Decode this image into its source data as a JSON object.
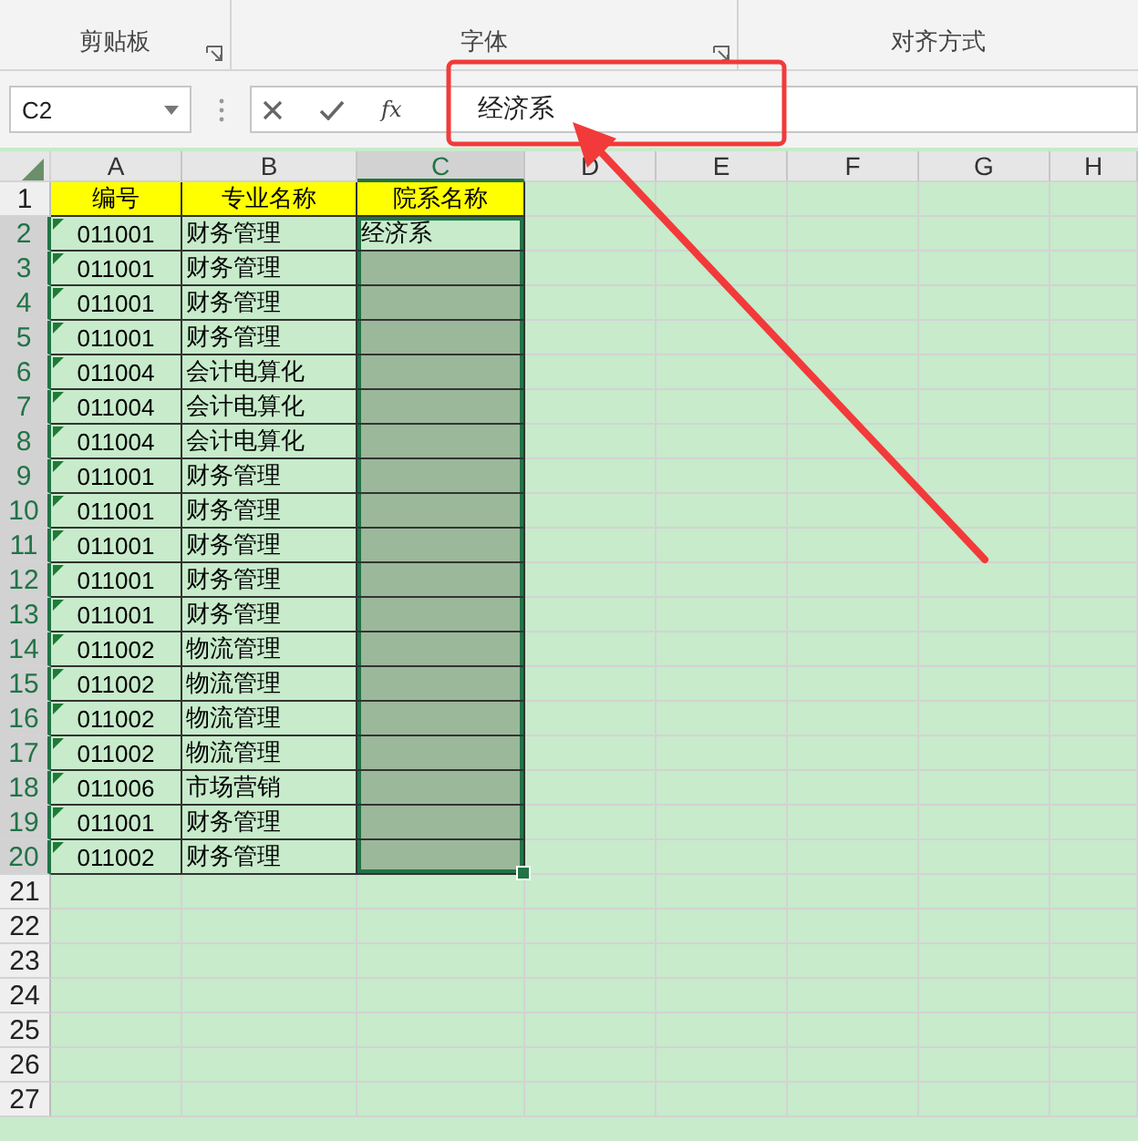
{
  "ribbon": {
    "groups": [
      {
        "label": "剪贴板",
        "launcher": true
      },
      {
        "label": "字体",
        "launcher": true
      },
      {
        "label": "对齐方式",
        "launcher": false
      }
    ]
  },
  "formula_bar": {
    "name_box": "C2",
    "function_label": "fx",
    "value": "经济系"
  },
  "sheet": {
    "columns": [
      {
        "label": "A",
        "selected": false
      },
      {
        "label": "B",
        "selected": false
      },
      {
        "label": "C",
        "selected": true
      },
      {
        "label": "D",
        "selected": false
      },
      {
        "label": "E",
        "selected": false
      },
      {
        "label": "F",
        "selected": false
      },
      {
        "label": "G",
        "selected": false
      },
      {
        "label": "H",
        "selected": false
      }
    ],
    "rows": [
      {
        "number": "1",
        "kind": "header",
        "selected": false,
        "flag": false,
        "cells": [
          "编号",
          "专业名称",
          "院系名称"
        ]
      },
      {
        "number": "2",
        "kind": "data",
        "selected": true,
        "flag": true,
        "cells": [
          "011001",
          "财务管理",
          "经济系"
        ]
      },
      {
        "number": "3",
        "kind": "data",
        "selected": true,
        "flag": true,
        "cells": [
          "011001",
          "财务管理",
          ""
        ]
      },
      {
        "number": "4",
        "kind": "data",
        "selected": true,
        "flag": true,
        "cells": [
          "011001",
          "财务管理",
          ""
        ]
      },
      {
        "number": "5",
        "kind": "data",
        "selected": true,
        "flag": true,
        "cells": [
          "011001",
          "财务管理",
          ""
        ]
      },
      {
        "number": "6",
        "kind": "data",
        "selected": true,
        "flag": true,
        "cells": [
          "011004",
          "会计电算化",
          ""
        ]
      },
      {
        "number": "7",
        "kind": "data",
        "selected": true,
        "flag": true,
        "cells": [
          "011004",
          "会计电算化",
          ""
        ]
      },
      {
        "number": "8",
        "kind": "data",
        "selected": true,
        "flag": true,
        "cells": [
          "011004",
          "会计电算化",
          ""
        ]
      },
      {
        "number": "9",
        "kind": "data",
        "selected": true,
        "flag": true,
        "cells": [
          "011001",
          "财务管理",
          ""
        ]
      },
      {
        "number": "10",
        "kind": "data",
        "selected": true,
        "flag": true,
        "cells": [
          "011001",
          "财务管理",
          ""
        ]
      },
      {
        "number": "11",
        "kind": "data",
        "selected": true,
        "flag": true,
        "cells": [
          "011001",
          "财务管理",
          ""
        ]
      },
      {
        "number": "12",
        "kind": "data",
        "selected": true,
        "flag": true,
        "cells": [
          "011001",
          "财务管理",
          ""
        ]
      },
      {
        "number": "13",
        "kind": "data",
        "selected": true,
        "flag": true,
        "cells": [
          "011001",
          "财务管理",
          ""
        ]
      },
      {
        "number": "14",
        "kind": "data",
        "selected": true,
        "flag": true,
        "cells": [
          "011002",
          "物流管理",
          ""
        ]
      },
      {
        "number": "15",
        "kind": "data",
        "selected": true,
        "flag": true,
        "cells": [
          "011002",
          "物流管理",
          ""
        ]
      },
      {
        "number": "16",
        "kind": "data",
        "selected": true,
        "flag": true,
        "cells": [
          "011002",
          "物流管理",
          ""
        ]
      },
      {
        "number": "17",
        "kind": "data",
        "selected": true,
        "flag": true,
        "cells": [
          "011002",
          "物流管理",
          ""
        ]
      },
      {
        "number": "18",
        "kind": "data",
        "selected": true,
        "flag": true,
        "cells": [
          "011006",
          "市场营销",
          ""
        ]
      },
      {
        "number": "19",
        "kind": "data",
        "selected": true,
        "flag": true,
        "cells": [
          "011001",
          "财务管理",
          ""
        ]
      },
      {
        "number": "20",
        "kind": "data",
        "selected": true,
        "flag": true,
        "cells": [
          "011002",
          "财务管理",
          ""
        ]
      },
      {
        "number": "21",
        "kind": "empty",
        "selected": false,
        "flag": false,
        "cells": []
      },
      {
        "number": "22",
        "kind": "empty",
        "selected": false,
        "flag": false,
        "cells": []
      },
      {
        "number": "23",
        "kind": "empty",
        "selected": false,
        "flag": false,
        "cells": []
      },
      {
        "number": "24",
        "kind": "empty",
        "selected": false,
        "flag": false,
        "cells": []
      },
      {
        "number": "25",
        "kind": "empty",
        "selected": false,
        "flag": false,
        "cells": []
      },
      {
        "number": "26",
        "kind": "empty",
        "selected": false,
        "flag": false,
        "cells": []
      },
      {
        "number": "27",
        "kind": "empty",
        "selected": false,
        "flag": false,
        "cells": []
      }
    ]
  }
}
